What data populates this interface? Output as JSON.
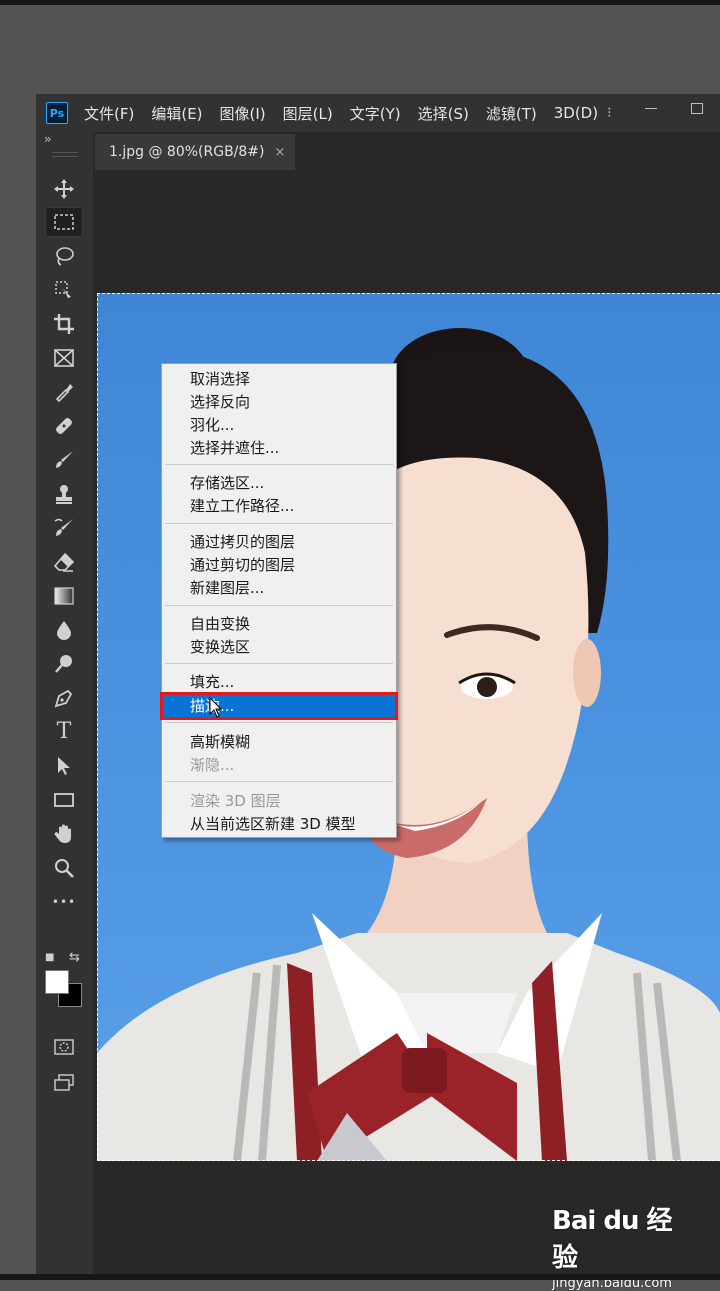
{
  "app": {
    "logo": "Ps"
  },
  "menubar": {
    "items": [
      "文件(F)",
      "编辑(E)",
      "图像(I)",
      "图层(L)",
      "文字(Y)",
      "选择(S)",
      "滤镜(T)",
      "3D(D)"
    ],
    "more": "⁝"
  },
  "tab": {
    "title": "1.jpg @ 80%(RGB/8#)",
    "close": "×"
  },
  "toolbar": {
    "collapse": "››",
    "tools": [
      "move-icon",
      "marquee-icon",
      "lasso-icon",
      "quick-select-icon",
      "crop-icon",
      "frame-icon",
      "eyedropper-icon",
      "healing-brush-icon",
      "brush-icon",
      "stamp-icon",
      "history-brush-icon",
      "eraser-icon",
      "gradient-icon",
      "blur-icon",
      "dodge-icon",
      "pen-icon",
      "type-icon",
      "path-select-icon",
      "rectangle-icon",
      "hand-icon",
      "zoom-icon",
      "more-tools-icon",
      "quick-mask-icon",
      "screen-mode-icon"
    ],
    "type_glyph": "T",
    "more_glyph": "•••",
    "foreground": "#ffffff",
    "background": "#000000"
  },
  "context_menu": {
    "items": [
      {
        "label": "取消选择",
        "disabled": false
      },
      {
        "label": "选择反向",
        "disabled": false
      },
      {
        "label": "羽化...",
        "disabled": false
      },
      {
        "label": "选择并遮住...",
        "disabled": false
      },
      {
        "label": "存储选区...",
        "disabled": false
      },
      {
        "label": "建立工作路径...",
        "disabled": false
      },
      {
        "label": "通过拷贝的图层",
        "disabled": false
      },
      {
        "label": "通过剪切的图层",
        "disabled": false
      },
      {
        "label": "新建图层...",
        "disabled": false
      },
      {
        "label": "自由变换",
        "disabled": false
      },
      {
        "label": "变换选区",
        "disabled": false
      },
      {
        "label": "填充...",
        "disabled": false
      },
      {
        "label": "描边...",
        "disabled": false,
        "highlighted": true
      },
      {
        "label": "高斯模糊",
        "disabled": false
      },
      {
        "label": "渐隐...",
        "disabled": true
      },
      {
        "label": "渲染 3D 图层",
        "disabled": true
      },
      {
        "label": "从当前选区新建 3D 模型",
        "disabled": false
      }
    ]
  },
  "watermark": {
    "logo": "Bai du 经验",
    "url": "jingyan.baidu.com"
  },
  "colors": {
    "highlight": "#0a74d4",
    "highlight_border": "#e11b1b",
    "ps_blue": "#31a8ff"
  }
}
